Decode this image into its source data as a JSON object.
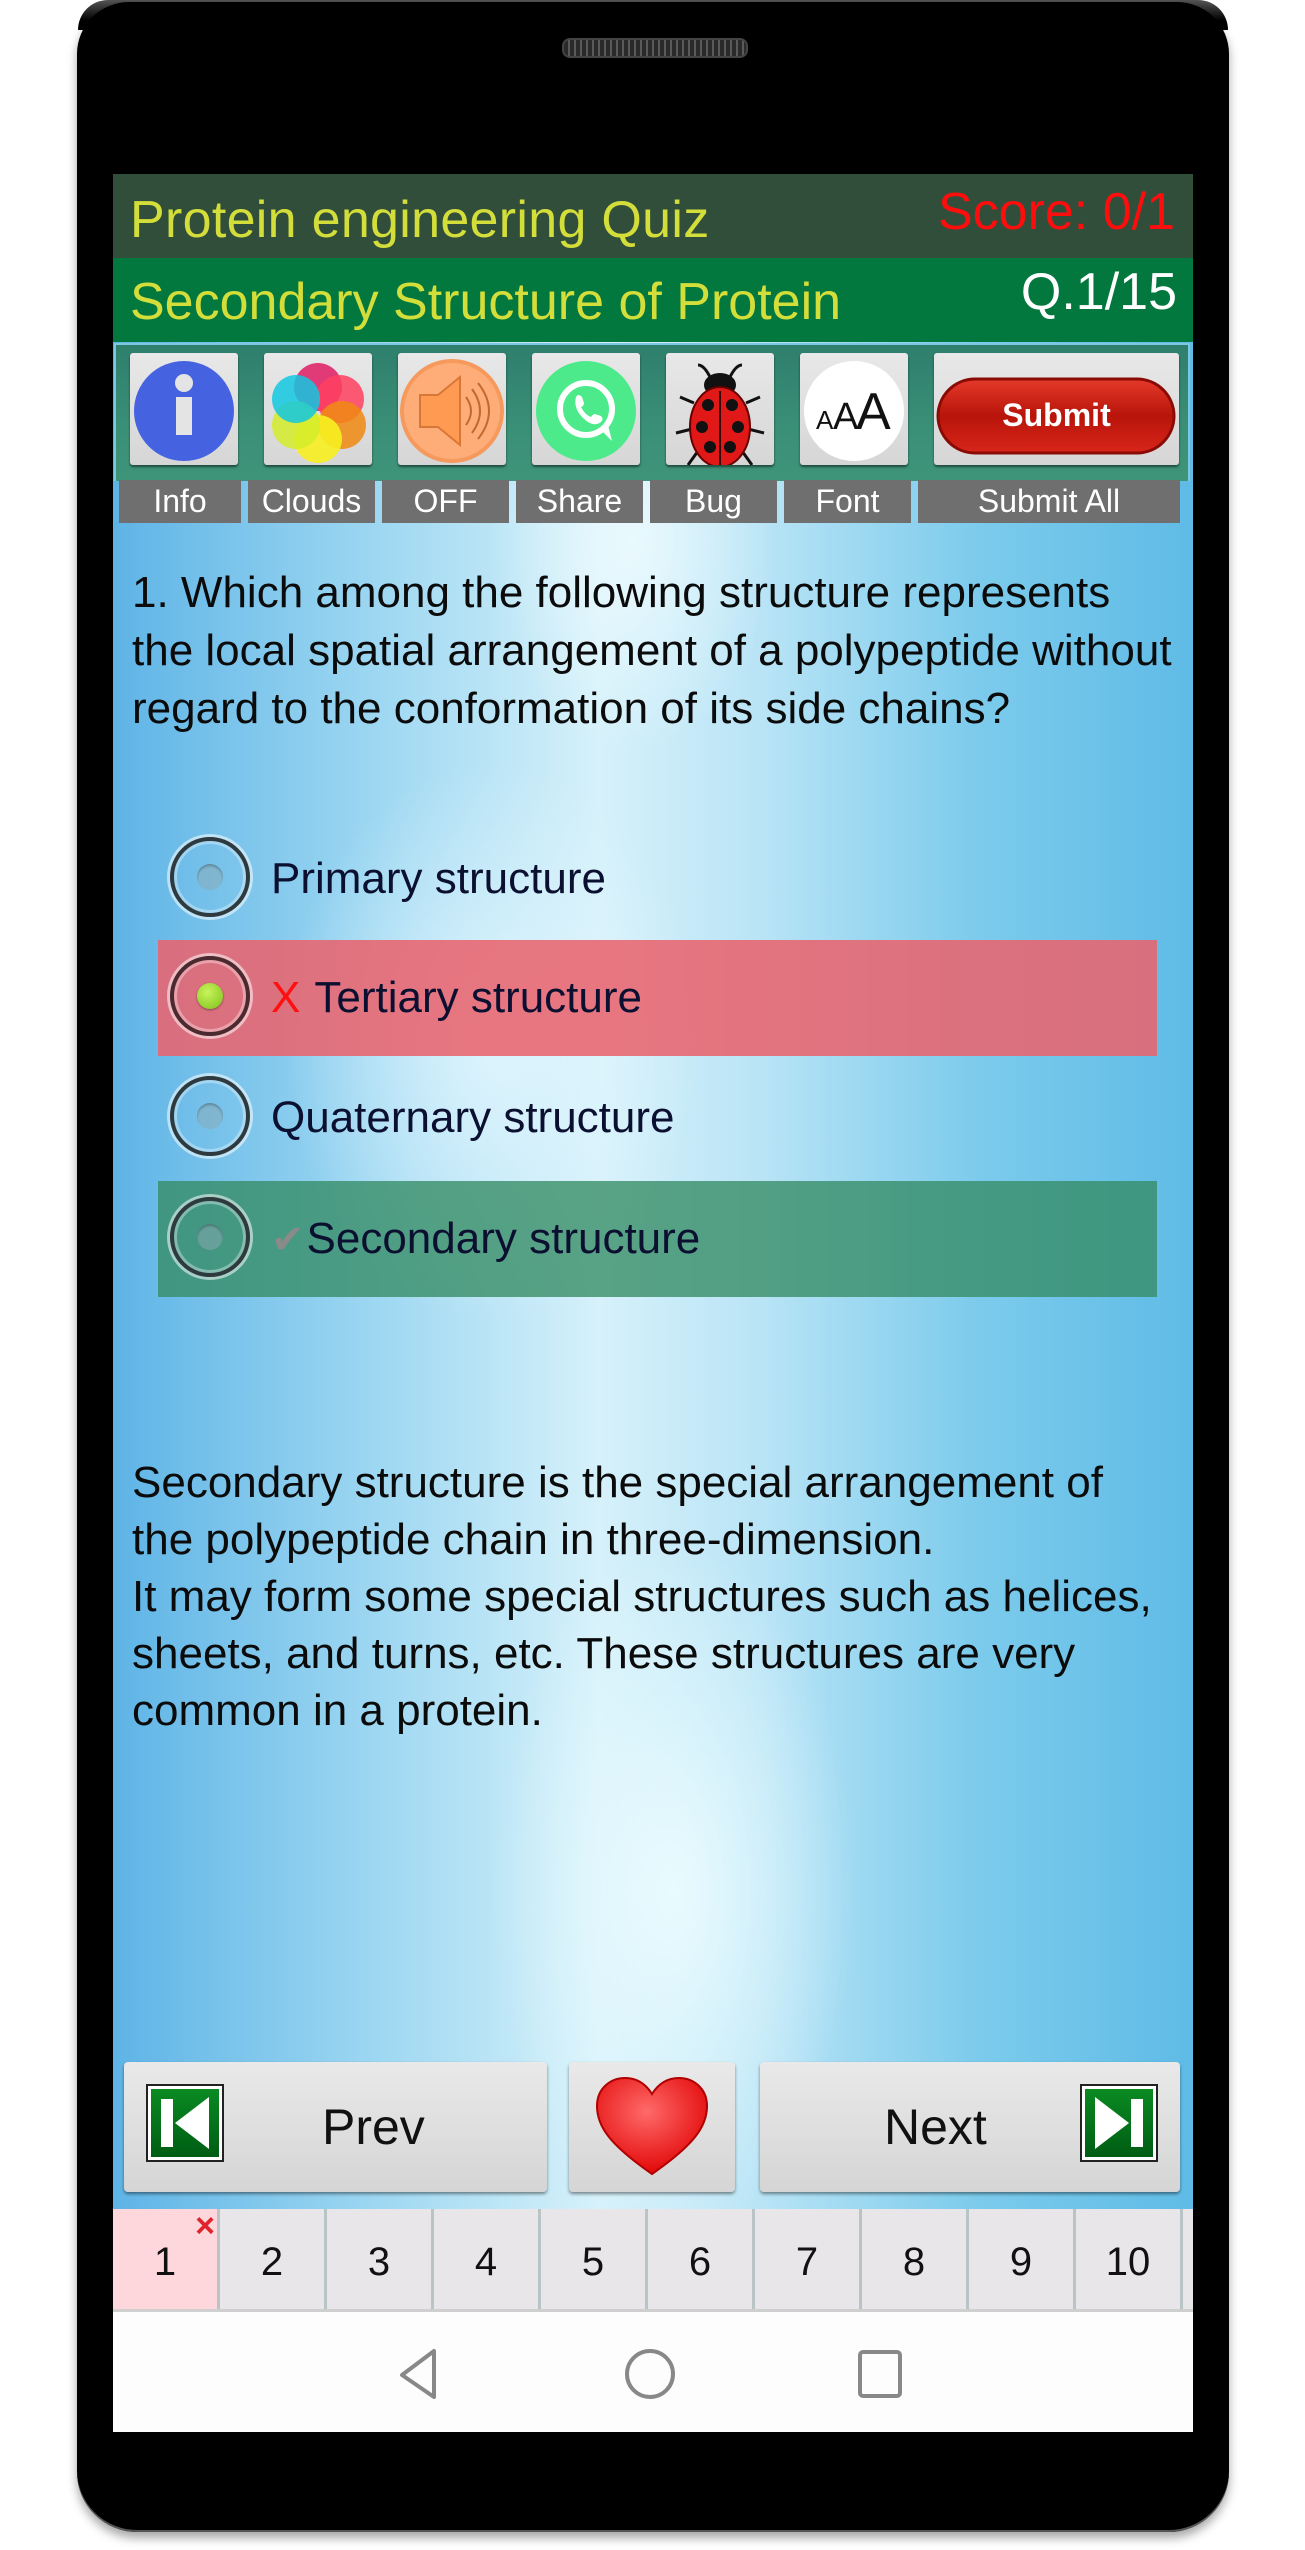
{
  "header": {
    "app_title": "Protein engineering Quiz",
    "score": "Score: 0/1",
    "topic": "Secondary Structure of Protein",
    "question_counter": "Q.1/15"
  },
  "toolbar": {
    "buttons": [
      {
        "id": "info",
        "label": "Info",
        "icon": "info-icon"
      },
      {
        "id": "clouds",
        "label": "Clouds",
        "icon": "color-petals-icon"
      },
      {
        "id": "sound",
        "label": "OFF",
        "icon": "speaker-icon"
      },
      {
        "id": "share",
        "label": "Share",
        "icon": "whatsapp-icon"
      },
      {
        "id": "bug",
        "label": "Bug",
        "icon": "ladybug-icon"
      },
      {
        "id": "font",
        "label": "Font",
        "icon": "font-size-icon"
      },
      {
        "id": "submit",
        "label": "Submit All",
        "icon": "submit-button",
        "button_text": "Submit"
      }
    ],
    "font_icon_text": "AAA"
  },
  "question": {
    "text": "1. Which among the following structure represents the local spatial arrangement of a polypeptide without regard to the conformation of its side chains?",
    "options": [
      {
        "text": "Primary structure",
        "selected": false,
        "state": "neutral",
        "mark": ""
      },
      {
        "text": "Tertiary structure",
        "selected": true,
        "state": "wrong",
        "mark": "X"
      },
      {
        "text": "Quaternary structure",
        "selected": false,
        "state": "neutral",
        "mark": ""
      },
      {
        "text": "Secondary structure",
        "selected": false,
        "state": "correct",
        "mark": "✔"
      }
    ],
    "explanation": "Secondary structure is the special arrangement of the polypeptide chain in three-dimension.\nIt may form some special structures such as helices, sheets, and turns, etc. These structures are very common in a protein."
  },
  "navigation": {
    "prev_label": "Prev",
    "next_label": "Next",
    "favorite_icon": "heart-icon"
  },
  "question_tabs": [
    {
      "label": "1",
      "state": "wrong",
      "badge": "×"
    },
    {
      "label": "2",
      "state": "unanswered",
      "badge": ""
    },
    {
      "label": "3",
      "state": "unanswered",
      "badge": ""
    },
    {
      "label": "4",
      "state": "unanswered",
      "badge": ""
    },
    {
      "label": "5",
      "state": "unanswered",
      "badge": ""
    },
    {
      "label": "6",
      "state": "unanswered",
      "badge": ""
    },
    {
      "label": "7",
      "state": "unanswered",
      "badge": ""
    },
    {
      "label": "8",
      "state": "unanswered",
      "badge": ""
    },
    {
      "label": "9",
      "state": "unanswered",
      "badge": ""
    },
    {
      "label": "10",
      "state": "unanswered",
      "badge": ""
    }
  ],
  "system_nav": [
    "back",
    "home",
    "recents"
  ],
  "colors": {
    "title_yellow": "#d4de3a",
    "score_red": "#ff0d0d",
    "header_dark": "#314e3a",
    "header_green": "#02783e",
    "wrong_row": "#e8646e",
    "correct_row": "#348c64"
  }
}
